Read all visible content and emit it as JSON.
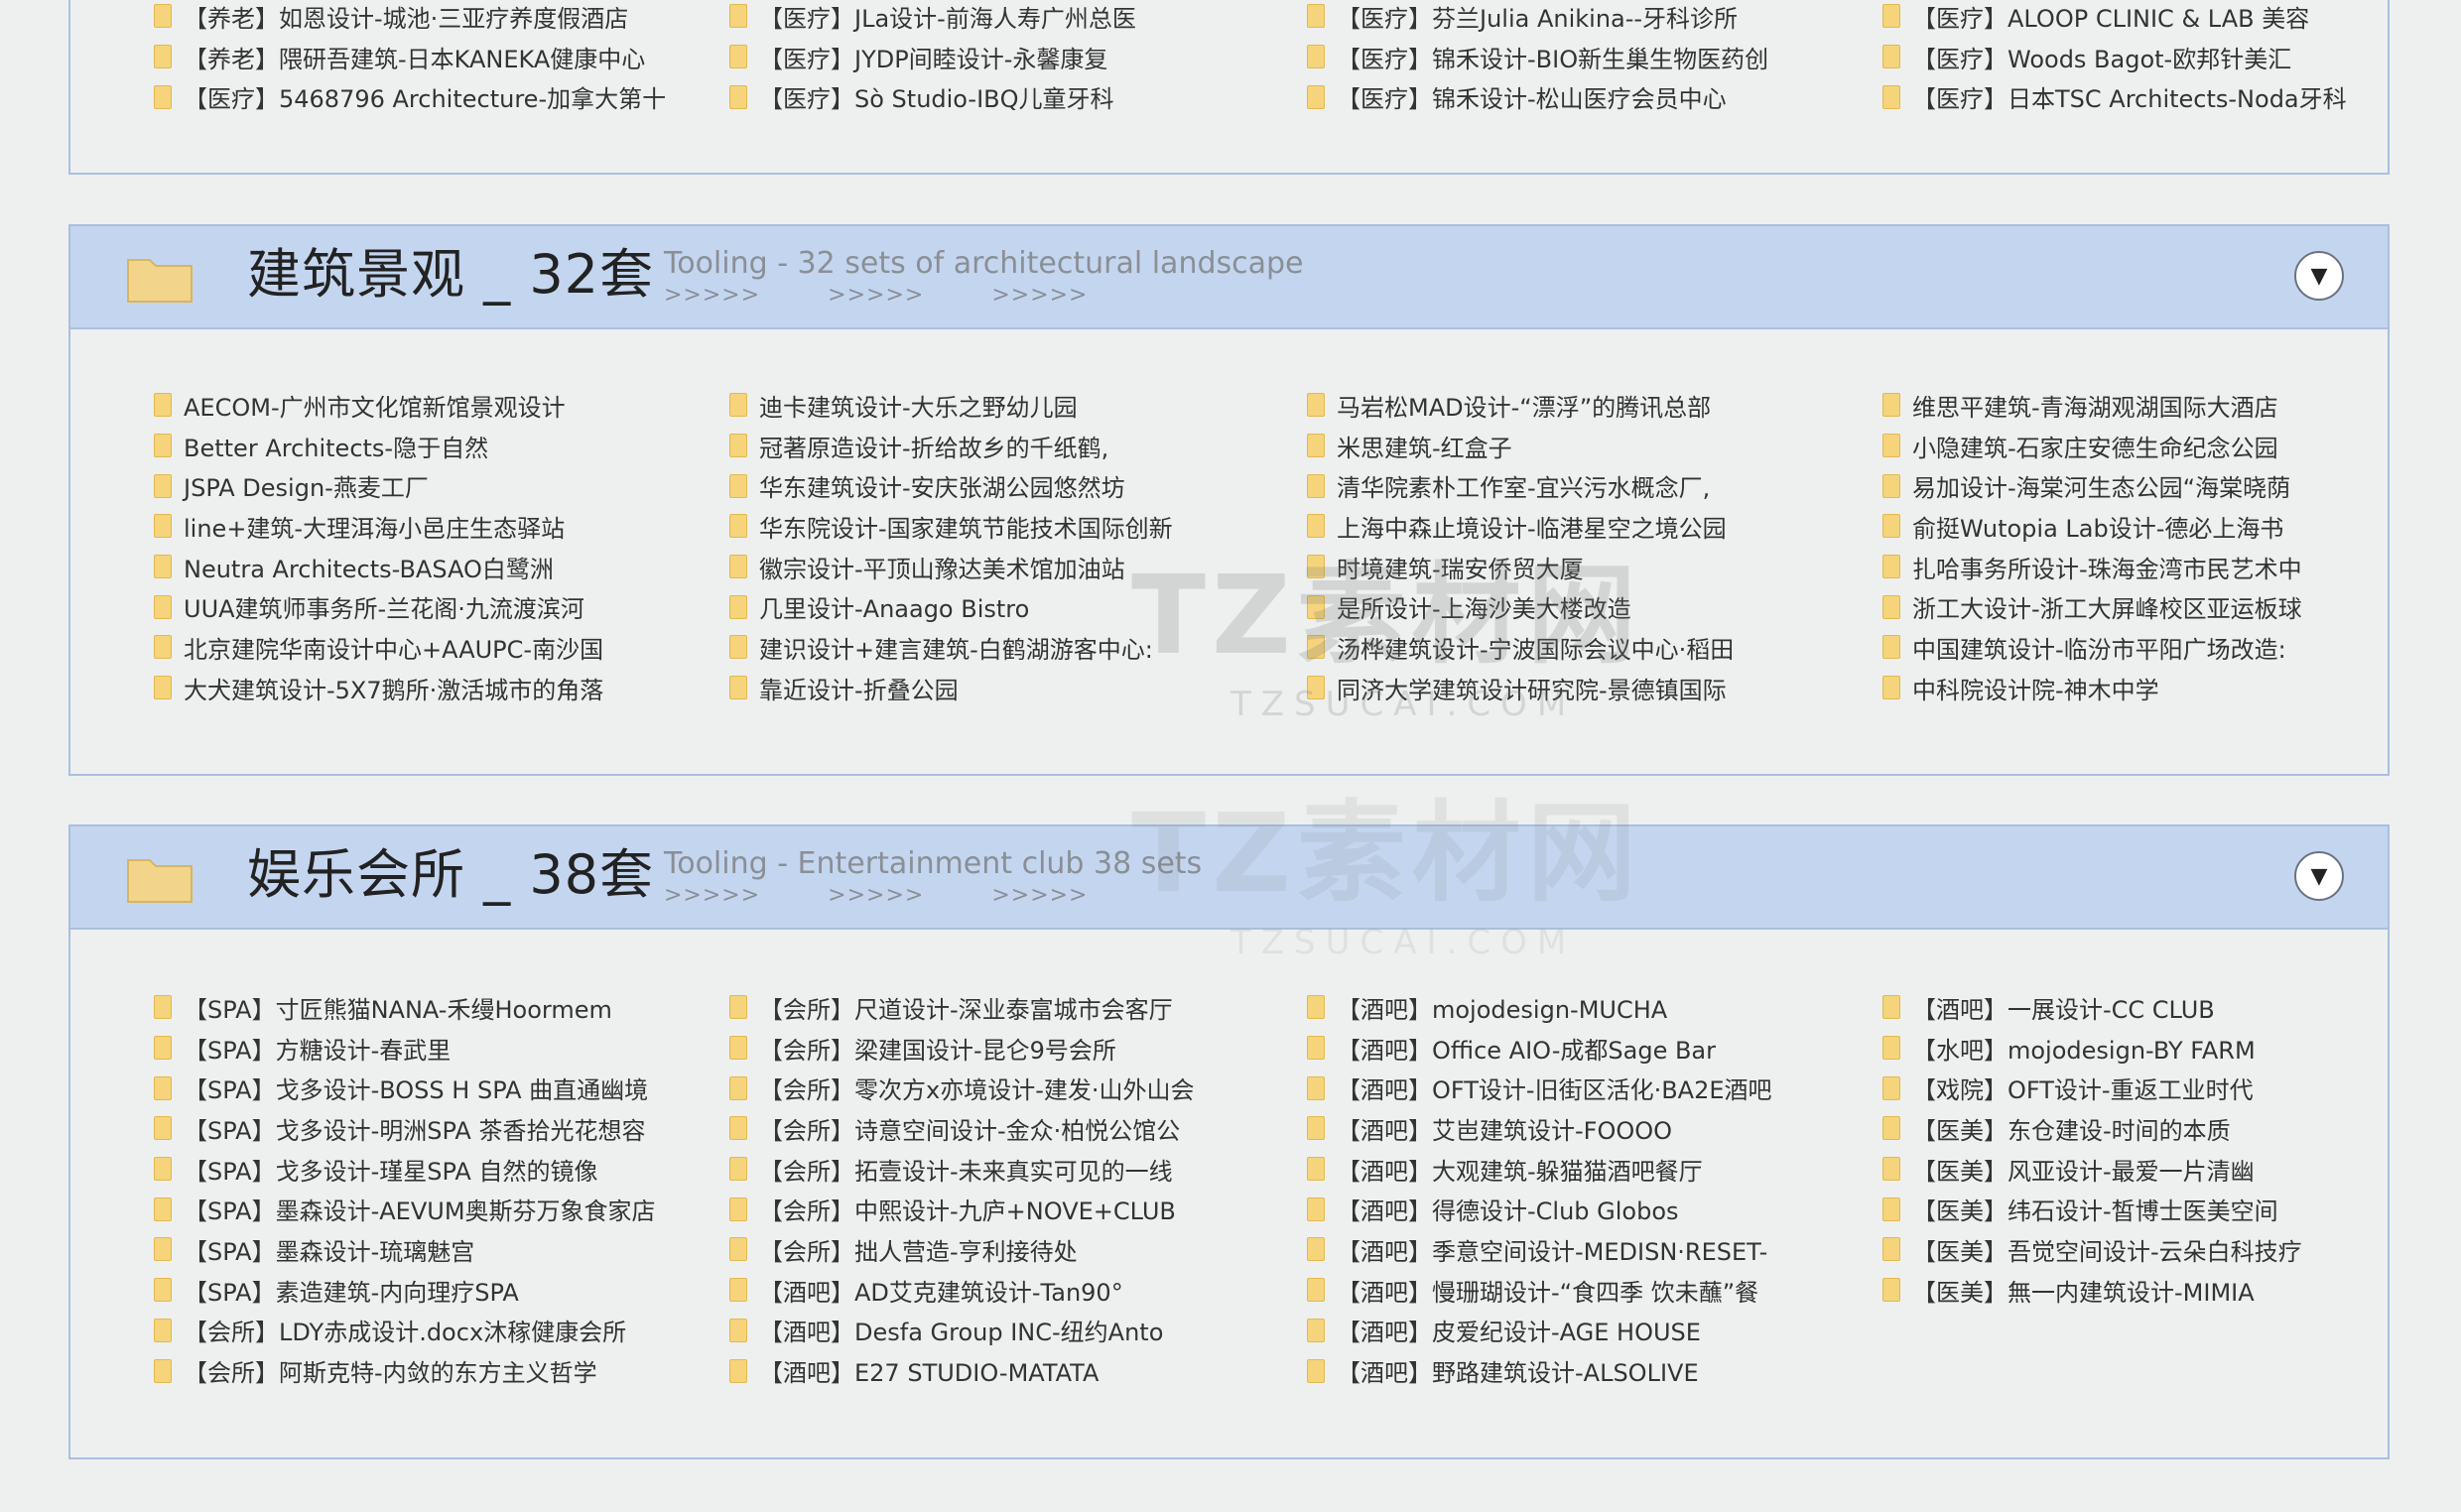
{
  "medical_tail": {
    "columns": [
      [
        "【养老】如恩设计-城池·三亚疗养度假酒店",
        "【养老】隈研吾建筑-日本KANEKA健康中心",
        "【医疗】5468796 Architecture-加拿大第十"
      ],
      [
        "【医疗】JLa设计-前海人寿广州总医",
        "【医疗】JYDP间睦设计-永馨康复",
        "【医疗】Sò Studio-IBQ儿童牙科"
      ],
      [
        "【医疗】芬兰Julia Anikina--牙科诊所",
        "【医疗】锦禾设计-BIO新生巢生物医药创",
        "【医疗】锦禾设计-松山医疗会员中心"
      ],
      [
        "【医疗】ALOOP CLINIC & LAB 美容",
        "【医疗】Woods Bagot-欧邦针美汇",
        "【医疗】日本TSC Architects-Noda牙科"
      ]
    ]
  },
  "sections": [
    {
      "title": "建筑景观 _ 32套",
      "subtitle": "Tooling - 32 sets of architectural landscape",
      "arrows": ">>>>> >>>>> >>>>>",
      "toggle": "▼",
      "columns": [
        [
          "AECOM-广州市文化馆新馆景观设计",
          "Better Architects-隐于自然",
          "JSPA Design-燕麦工厂",
          "line+建筑-大理洱海小邑庄生态驿站",
          "Neutra Architects-BASAO白鹭洲",
          "UUA建筑师事务所-兰花阁·九流渡滨河",
          "北京建院华南设计中心+AAUPC-南沙国",
          "大犬建筑设计-5X7鹅所·激活城市的角落"
        ],
        [
          "迪卡建筑设计-大乐之野幼儿园",
          "冠著原造设计-折给故乡的千纸鹤,",
          "华东建筑设计-安庆张湖公园悠然坊",
          "华东院设计-国家建筑节能技术国际创新",
          "徽宗设计-平顶山豫达美术馆加油站",
          "几里设计-Anaago Bistro",
          "建识设计+建言建筑-白鹤湖游客中心:",
          "靠近设计-折叠公园"
        ],
        [
          "马岩松MAD设计-“漂浮”的腾讯总部",
          "米思建筑-红盒子",
          "清华院素朴工作室-宜兴污水概念厂,",
          "上海中森止境设计-临港星空之境公园",
          "时境建筑-瑞安侨贸大厦",
          "是所设计-上海沙美大楼改造",
          "汤桦建筑设计-宁波国际会议中心·稻田",
          "同济大学建筑设计研究院-景德镇国际"
        ],
        [
          "维思平建筑-青海湖观湖国际大酒店",
          "小隐建筑-石家庄安德生命纪念公园",
          "易加设计-海棠河生态公园“海棠晓荫",
          "俞挺Wutopia Lab设计-德必上海书",
          "扎哈事务所设计-珠海金湾市民艺术中",
          "浙工大设计-浙工大屏峰校区亚运板球",
          "中国建筑设计-临汾市平阳广场改造:",
          "中科院设计院-神木中学"
        ]
      ]
    },
    {
      "title": "娱乐会所 _ 38套",
      "subtitle": "Tooling - Entertainment club 38 sets",
      "arrows": ">>>>> >>>>> >>>>>",
      "toggle": "▼",
      "columns": [
        [
          "【SPA】寸匠熊猫NANA-禾缦Hoormem",
          "【SPA】方糖设计-春武里",
          "【SPA】戈多设计-BOSS H SPA 曲直通幽境",
          "【SPA】戈多设计-明洲SPA 茶香拾光花想容",
          "【SPA】戈多设计-瑾星SPA 自然的镜像",
          "【SPA】墨森设计-AEVUM奥斯芬万象食家店",
          "【SPA】墨森设计-琉璃魅宫",
          "【SPA】素造建筑-内向理疗SPA",
          "【会所】LDY赤成设计.docx沐稼健康会所",
          "【会所】阿斯克特-内敛的东方主义哲学"
        ],
        [
          "【会所】尺道设计-深业泰富城市会客厅",
          "【会所】梁建国设计-昆仑9号会所",
          "【会所】零次方x亦境设计-建发·山外山会",
          "【会所】诗意空间设计-金众·柏悦公馆公",
          "【会所】拓壹设计-未来真实可见的一线",
          "【会所】中熙设计-九庐+NOVE+CLUB",
          "【会所】拙人营造-亨利接待处",
          "【酒吧】AD艾克建筑设计-Tan90°",
          "【酒吧】Desfa Group INC-纽约Anto",
          "【酒吧】E27 STUDIO-MATATA"
        ],
        [
          "【酒吧】mojodesign-MUCHA",
          "【酒吧】Office AIO-成都Sage Bar",
          "【酒吧】OFT设计-旧街区活化·BA2E酒吧",
          "【酒吧】艾岜建筑设计-FOOOO",
          "【酒吧】大观建筑-躲猫猫酒吧餐厅",
          "【酒吧】得德设计-Club Globos",
          "【酒吧】季意空间设计-MEDISN·RESET-",
          "【酒吧】慢珊瑚设计-“食四季 饮未蘸”餐",
          "【酒吧】皮爱纪设计-AGE HOUSE",
          "【酒吧】野路建筑设计-ALSOLIVE"
        ],
        [
          "【酒吧】一展设计-CC CLUB",
          "【水吧】mojodesign-BY FARM",
          "【戏院】OFT设计-重返工业时代",
          "【医美】东仓建设-时间的本质",
          "【医美】风亚设计-最爱一片清幽",
          "【医美】纬石设计-皙博士医美空间",
          "【医美】吾觉空间设计-云朵白科技疗",
          "【医美】無一内建筑设计-MIMIA"
        ]
      ]
    }
  ],
  "watermark": {
    "text": "TZ素材网",
    "sub": "TZSUCAI.COM"
  }
}
